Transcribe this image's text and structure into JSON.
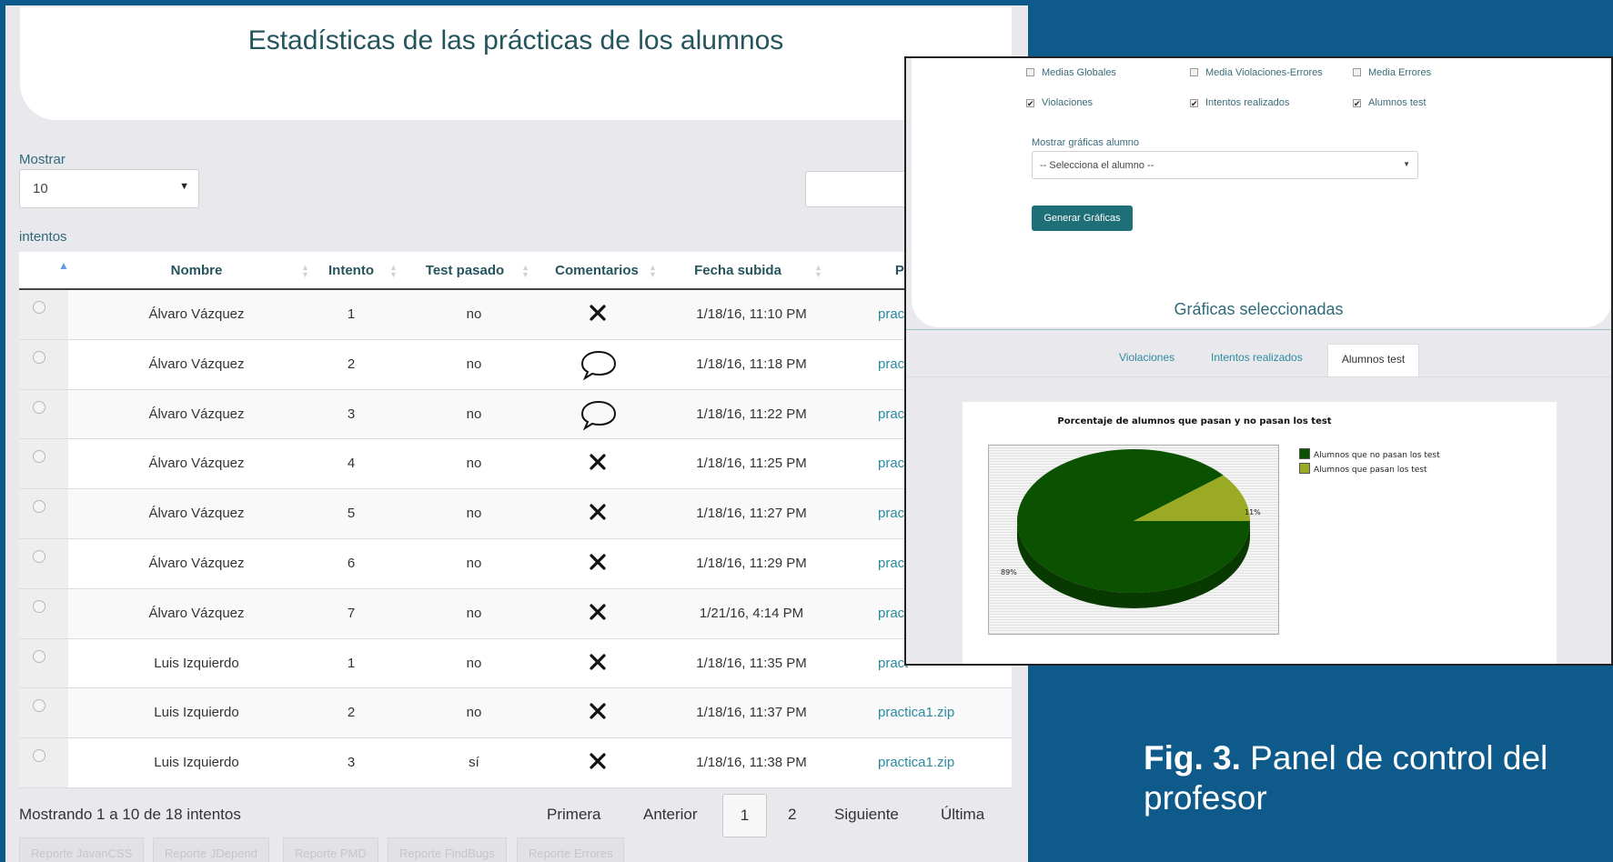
{
  "main": {
    "title": "Estadísticas de las prácticas de los alumnos",
    "show_label": "Mostrar",
    "page_length": "10",
    "entries_label": "intentos",
    "columns": [
      "Nombre",
      "Intento",
      "Test pasado",
      "Comentarios",
      "Fecha subida",
      "Prá"
    ],
    "rows": [
      {
        "name": "Álvaro Vázquez",
        "attempt": "1",
        "passed": "no",
        "comment": "none",
        "date": "1/18/16, 11:10 PM",
        "file": "pract"
      },
      {
        "name": "Álvaro Vázquez",
        "attempt": "2",
        "passed": "no",
        "comment": "bubble",
        "date": "1/18/16, 11:18 PM",
        "file": "pract"
      },
      {
        "name": "Álvaro Vázquez",
        "attempt": "3",
        "passed": "no",
        "comment": "bubble",
        "date": "1/18/16, 11:22 PM",
        "file": "pract"
      },
      {
        "name": "Álvaro Vázquez",
        "attempt": "4",
        "passed": "no",
        "comment": "none",
        "date": "1/18/16, 11:25 PM",
        "file": "pract"
      },
      {
        "name": "Álvaro Vázquez",
        "attempt": "5",
        "passed": "no",
        "comment": "none",
        "date": "1/18/16, 11:27 PM",
        "file": "pract"
      },
      {
        "name": "Álvaro Vázquez",
        "attempt": "6",
        "passed": "no",
        "comment": "none",
        "date": "1/18/16, 11:29 PM",
        "file": "pract"
      },
      {
        "name": "Álvaro Vázquez",
        "attempt": "7",
        "passed": "no",
        "comment": "none",
        "date": "1/21/16, 4:14 PM",
        "file": "pract"
      },
      {
        "name": "Luis Izquierdo",
        "attempt": "1",
        "passed": "no",
        "comment": "none",
        "date": "1/18/16, 11:35 PM",
        "file": "pract"
      },
      {
        "name": "Luis Izquierdo",
        "attempt": "2",
        "passed": "no",
        "comment": "none",
        "date": "1/18/16, 11:37 PM",
        "file": "practica1.zip"
      },
      {
        "name": "Luis Izquierdo",
        "attempt": "3",
        "passed": "sí",
        "comment": "none",
        "date": "1/18/16, 11:38 PM",
        "file": "practica1.zip"
      }
    ],
    "info": "Mostrando 1 a 10 de 18 intentos",
    "pager": {
      "first": "Primera",
      "prev": "Anterior",
      "current": "1",
      "next_page": "2",
      "next": "Siguiente",
      "last": "Última"
    },
    "reports": [
      "Reporte JavanCSS",
      "Reporte JDepend",
      "Reporte PMD",
      "Reporte FindBugs",
      "Reporte Errores"
    ]
  },
  "overlay": {
    "checkboxes": [
      {
        "label": "Medias Globales",
        "checked": false
      },
      {
        "label": "Media Violaciones-Errores",
        "checked": false
      },
      {
        "label": "Media Errores",
        "checked": false
      },
      {
        "label": "Violaciones",
        "checked": true
      },
      {
        "label": "Intentos realizados",
        "checked": true
      },
      {
        "label": "Alumnos test",
        "checked": true
      }
    ],
    "student_label": "Mostrar gráficas alumno",
    "student_select": "-- Selecciona el alumno --",
    "generate_button": "Generar Gráficas",
    "selected_title": "Gráficas seleccionadas",
    "tabs": [
      "Violaciones",
      "Intentos realizados",
      "Alumnos test"
    ],
    "active_tab": "Alumnos test"
  },
  "chart_data": {
    "type": "pie",
    "title": "Porcentaje de alumnos que pasan y no pasan los test",
    "series": [
      {
        "name": "Alumnos que no pasan los test",
        "value": 89,
        "label": "89%",
        "color": "#0b5200"
      },
      {
        "name": "Alumnos que pasan los test",
        "value": 11,
        "label": "11%",
        "color": "#9aaa24"
      }
    ]
  },
  "caption": {
    "bold": "Fig. 3.",
    "text": " Panel de control del profesor"
  },
  "colors": {
    "background": "#0e5a8a",
    "accent": "#1f6f78",
    "link": "#2a8aa0"
  }
}
